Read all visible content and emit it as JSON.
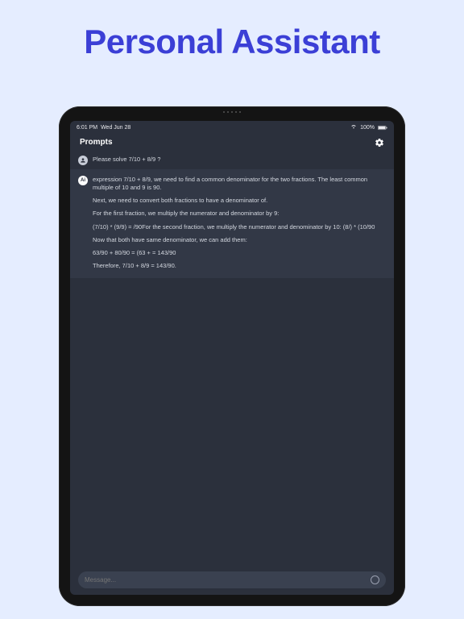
{
  "hero": {
    "title": "Personal Assistant"
  },
  "status": {
    "time": "6:01 PM",
    "date": "Wed Jun 28",
    "battery_pct": "100%"
  },
  "header": {
    "title": "Prompts"
  },
  "user_message": {
    "text": "Please solve 7/10 + 8/9 ?"
  },
  "ai_message": {
    "avatar_label": "Ai",
    "p1": "expression 7/10 + 8/9, we need to find a common denominator for the two fractions. The least common multiple of 10 and 9 is 90.",
    "p2": "Next, we need to convert both fractions to have a denominator of.",
    "p3": "For the first fraction, we multiply the numerator and denominator by 9:",
    "p4": "(7/10) * (9/9) = /90For the second fraction, we multiply the numerator and denominator by 10: (8/) * (10/90",
    "p5": "Now that both have same denominator, we can add them:",
    "p6": "63/90 + 80/90 = (63 +  = 143/90",
    "p7": "Therefore, 7/10 + 8/9 = 143/90."
  },
  "input": {
    "placeholder": "Message..."
  }
}
